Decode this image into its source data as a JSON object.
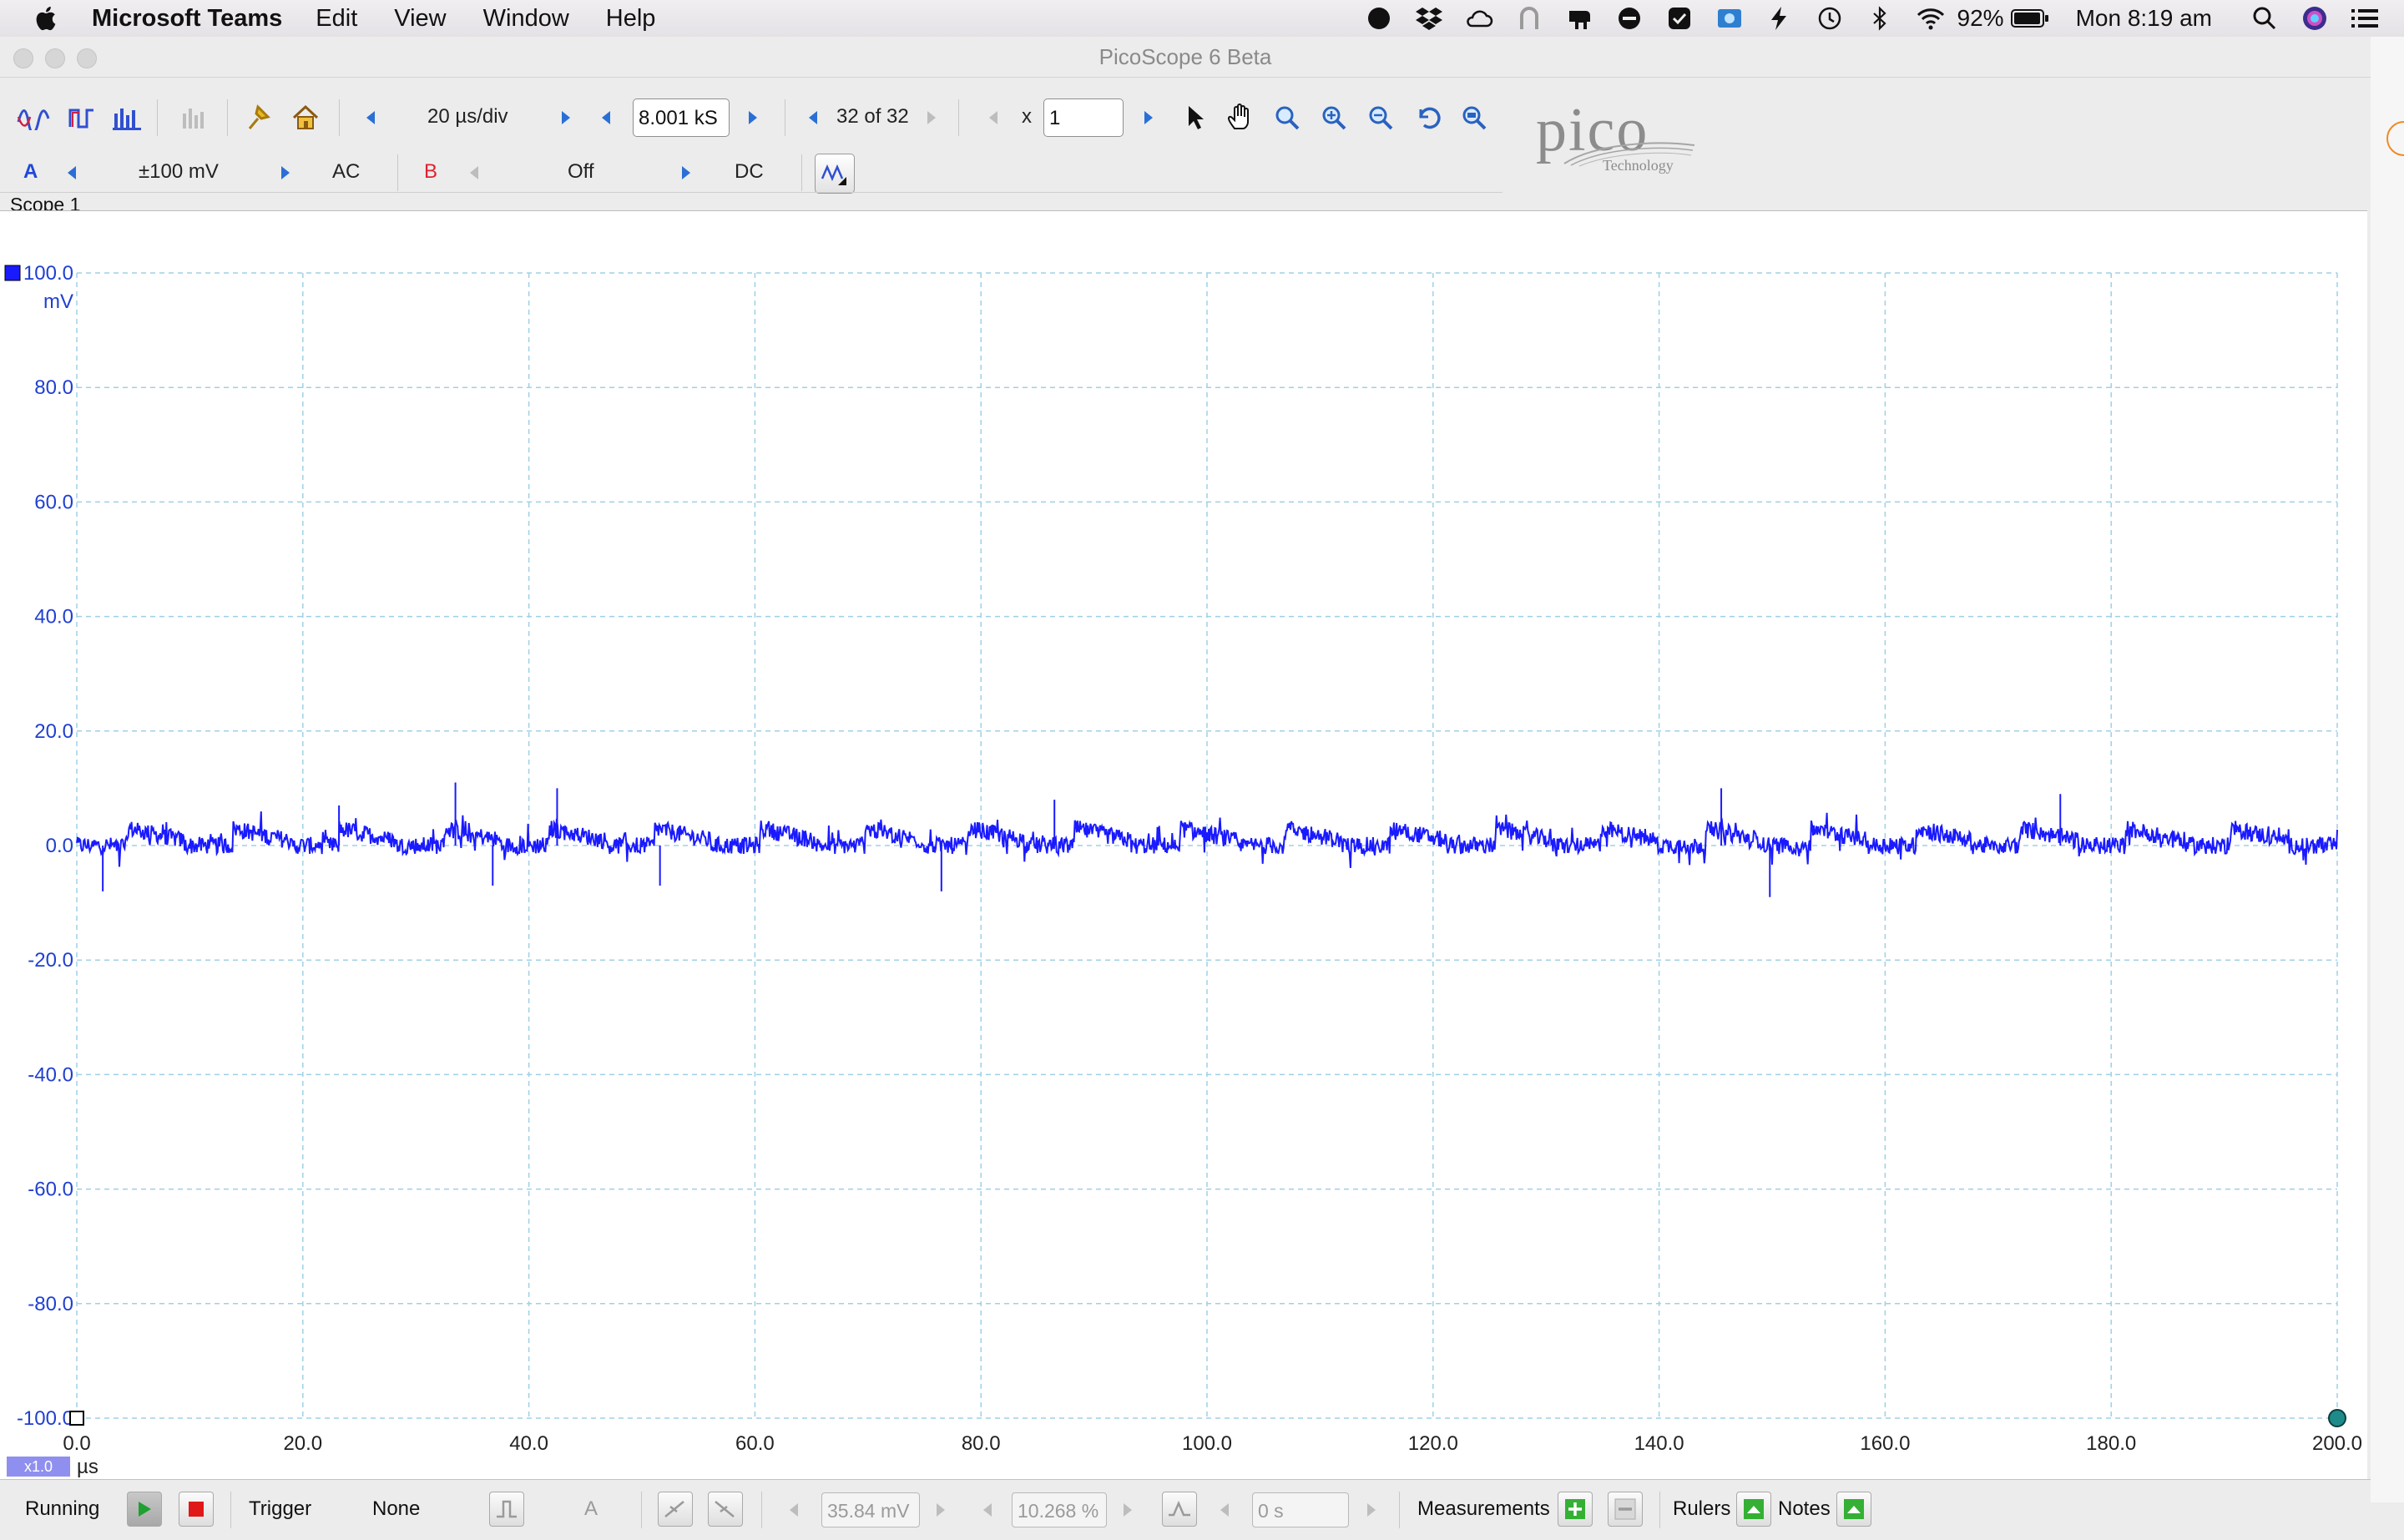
{
  "menubar": {
    "app_name": "Microsoft Teams",
    "items": [
      "Edit",
      "View",
      "Window",
      "Help"
    ],
    "battery": "92%",
    "clock": "Mon 8:19 am"
  },
  "window": {
    "title": "PicoScope 6 Beta"
  },
  "toolbar1": {
    "timebase": "20 µs/div",
    "samples": "8.001 kS",
    "buffer": "32 of 32",
    "zoom_prefix": "x",
    "zoom_value": "1"
  },
  "toolbar2": {
    "channel_a": "A",
    "range_a": "±100 mV",
    "coupling_a": "AC",
    "channel_b": "B",
    "range_b": "Off",
    "coupling_b": "DC"
  },
  "logo": {
    "word": "pico",
    "sub": "Technology"
  },
  "scope": {
    "label": "Scope 1",
    "x_unit": "µs",
    "y_unit": "mV",
    "zoom_badge": "x1.0"
  },
  "chart_data": {
    "type": "line",
    "title": "",
    "xlabel": "µs",
    "ylabel": "mV",
    "xlim": [
      0,
      200
    ],
    "ylim": [
      -100,
      100
    ],
    "x_ticks": [
      0,
      20,
      40,
      60,
      80,
      100,
      120,
      140,
      160,
      180,
      200
    ],
    "x_tick_labels": [
      "0.0",
      "20.0",
      "40.0",
      "60.0",
      "80.0",
      "100.0",
      "120.0",
      "140.0",
      "160.0",
      "180.0",
      "200.0"
    ],
    "y_ticks": [
      100,
      80,
      60,
      40,
      20,
      0,
      -20,
      -40,
      -60,
      -80,
      -100
    ],
    "y_tick_labels": [
      "100.0",
      "80.0",
      "60.0",
      "40.0",
      "20.0",
      "0.0",
      "-20.0",
      "-40.0",
      "-60.0",
      "-80.0",
      "-100.0"
    ],
    "grid": true,
    "series": [
      {
        "color": "#1a1aff",
        "pulse_starts": [
          4.5,
          13.8,
          23.2,
          32.5,
          41.8,
          51.1,
          60.4,
          69.7,
          79.0,
          88.3,
          97.6,
          106.9,
          116.2,
          125.5,
          134.8,
          144.1,
          153.4,
          162.7,
          172.0,
          181.3,
          190.6
        ],
        "pulse_step": 3,
        "baseline": 0,
        "noise": 1.5,
        "spikes": [
          {
            "x": 23.2,
            "y": 7
          },
          {
            "x": 33.5,
            "y": 11
          },
          {
            "x": 42.5,
            "y": 10
          },
          {
            "x": 51.6,
            "y": -7
          },
          {
            "x": 76.5,
            "y": -8
          },
          {
            "x": 86.5,
            "y": 8
          },
          {
            "x": 145.5,
            "y": 10
          },
          {
            "x": 149.8,
            "y": -9
          },
          {
            "x": 175.5,
            "y": 9
          },
          {
            "x": 2.3,
            "y": -8
          },
          {
            "x": 36.8,
            "y": -7
          }
        ]
      }
    ]
  }
}
